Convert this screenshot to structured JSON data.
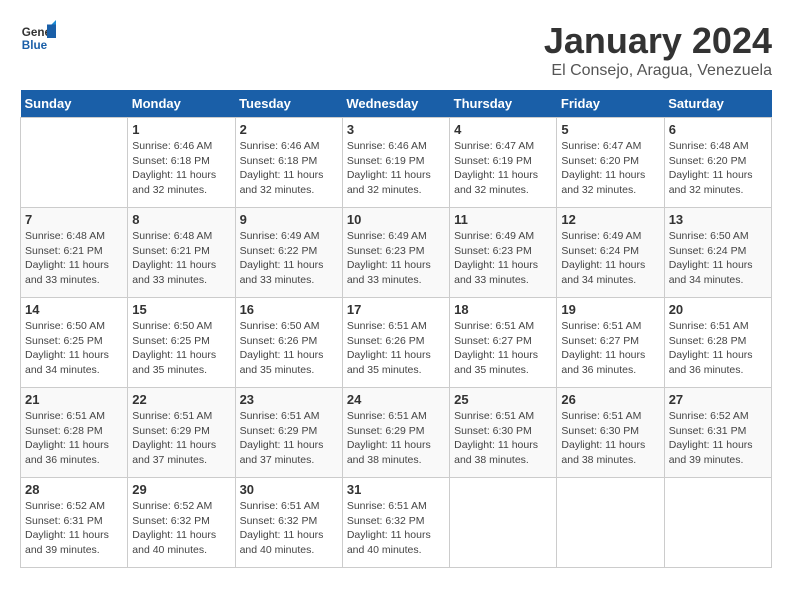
{
  "logo": {
    "general": "General",
    "blue": "Blue"
  },
  "title": "January 2024",
  "subtitle": "El Consejo, Aragua, Venezuela",
  "days_of_week": [
    "Sunday",
    "Monday",
    "Tuesday",
    "Wednesday",
    "Thursday",
    "Friday",
    "Saturday"
  ],
  "weeks": [
    [
      {
        "day": "",
        "info": ""
      },
      {
        "day": "1",
        "info": "Sunrise: 6:46 AM\nSunset: 6:18 PM\nDaylight: 11 hours\nand 32 minutes."
      },
      {
        "day": "2",
        "info": "Sunrise: 6:46 AM\nSunset: 6:18 PM\nDaylight: 11 hours\nand 32 minutes."
      },
      {
        "day": "3",
        "info": "Sunrise: 6:46 AM\nSunset: 6:19 PM\nDaylight: 11 hours\nand 32 minutes."
      },
      {
        "day": "4",
        "info": "Sunrise: 6:47 AM\nSunset: 6:19 PM\nDaylight: 11 hours\nand 32 minutes."
      },
      {
        "day": "5",
        "info": "Sunrise: 6:47 AM\nSunset: 6:20 PM\nDaylight: 11 hours\nand 32 minutes."
      },
      {
        "day": "6",
        "info": "Sunrise: 6:48 AM\nSunset: 6:20 PM\nDaylight: 11 hours\nand 32 minutes."
      }
    ],
    [
      {
        "day": "7",
        "info": "Sunrise: 6:48 AM\nSunset: 6:21 PM\nDaylight: 11 hours\nand 33 minutes."
      },
      {
        "day": "8",
        "info": "Sunrise: 6:48 AM\nSunset: 6:21 PM\nDaylight: 11 hours\nand 33 minutes."
      },
      {
        "day": "9",
        "info": "Sunrise: 6:49 AM\nSunset: 6:22 PM\nDaylight: 11 hours\nand 33 minutes."
      },
      {
        "day": "10",
        "info": "Sunrise: 6:49 AM\nSunset: 6:23 PM\nDaylight: 11 hours\nand 33 minutes."
      },
      {
        "day": "11",
        "info": "Sunrise: 6:49 AM\nSunset: 6:23 PM\nDaylight: 11 hours\nand 33 minutes."
      },
      {
        "day": "12",
        "info": "Sunrise: 6:49 AM\nSunset: 6:24 PM\nDaylight: 11 hours\nand 34 minutes."
      },
      {
        "day": "13",
        "info": "Sunrise: 6:50 AM\nSunset: 6:24 PM\nDaylight: 11 hours\nand 34 minutes."
      }
    ],
    [
      {
        "day": "14",
        "info": "Sunrise: 6:50 AM\nSunset: 6:25 PM\nDaylight: 11 hours\nand 34 minutes."
      },
      {
        "day": "15",
        "info": "Sunrise: 6:50 AM\nSunset: 6:25 PM\nDaylight: 11 hours\nand 35 minutes."
      },
      {
        "day": "16",
        "info": "Sunrise: 6:50 AM\nSunset: 6:26 PM\nDaylight: 11 hours\nand 35 minutes."
      },
      {
        "day": "17",
        "info": "Sunrise: 6:51 AM\nSunset: 6:26 PM\nDaylight: 11 hours\nand 35 minutes."
      },
      {
        "day": "18",
        "info": "Sunrise: 6:51 AM\nSunset: 6:27 PM\nDaylight: 11 hours\nand 35 minutes."
      },
      {
        "day": "19",
        "info": "Sunrise: 6:51 AM\nSunset: 6:27 PM\nDaylight: 11 hours\nand 36 minutes."
      },
      {
        "day": "20",
        "info": "Sunrise: 6:51 AM\nSunset: 6:28 PM\nDaylight: 11 hours\nand 36 minutes."
      }
    ],
    [
      {
        "day": "21",
        "info": "Sunrise: 6:51 AM\nSunset: 6:28 PM\nDaylight: 11 hours\nand 36 minutes."
      },
      {
        "day": "22",
        "info": "Sunrise: 6:51 AM\nSunset: 6:29 PM\nDaylight: 11 hours\nand 37 minutes."
      },
      {
        "day": "23",
        "info": "Sunrise: 6:51 AM\nSunset: 6:29 PM\nDaylight: 11 hours\nand 37 minutes."
      },
      {
        "day": "24",
        "info": "Sunrise: 6:51 AM\nSunset: 6:29 PM\nDaylight: 11 hours\nand 38 minutes."
      },
      {
        "day": "25",
        "info": "Sunrise: 6:51 AM\nSunset: 6:30 PM\nDaylight: 11 hours\nand 38 minutes."
      },
      {
        "day": "26",
        "info": "Sunrise: 6:51 AM\nSunset: 6:30 PM\nDaylight: 11 hours\nand 38 minutes."
      },
      {
        "day": "27",
        "info": "Sunrise: 6:52 AM\nSunset: 6:31 PM\nDaylight: 11 hours\nand 39 minutes."
      }
    ],
    [
      {
        "day": "28",
        "info": "Sunrise: 6:52 AM\nSunset: 6:31 PM\nDaylight: 11 hours\nand 39 minutes."
      },
      {
        "day": "29",
        "info": "Sunrise: 6:52 AM\nSunset: 6:32 PM\nDaylight: 11 hours\nand 40 minutes."
      },
      {
        "day": "30",
        "info": "Sunrise: 6:51 AM\nSunset: 6:32 PM\nDaylight: 11 hours\nand 40 minutes."
      },
      {
        "day": "31",
        "info": "Sunrise: 6:51 AM\nSunset: 6:32 PM\nDaylight: 11 hours\nand 40 minutes."
      },
      {
        "day": "",
        "info": ""
      },
      {
        "day": "",
        "info": ""
      },
      {
        "day": "",
        "info": ""
      }
    ]
  ]
}
